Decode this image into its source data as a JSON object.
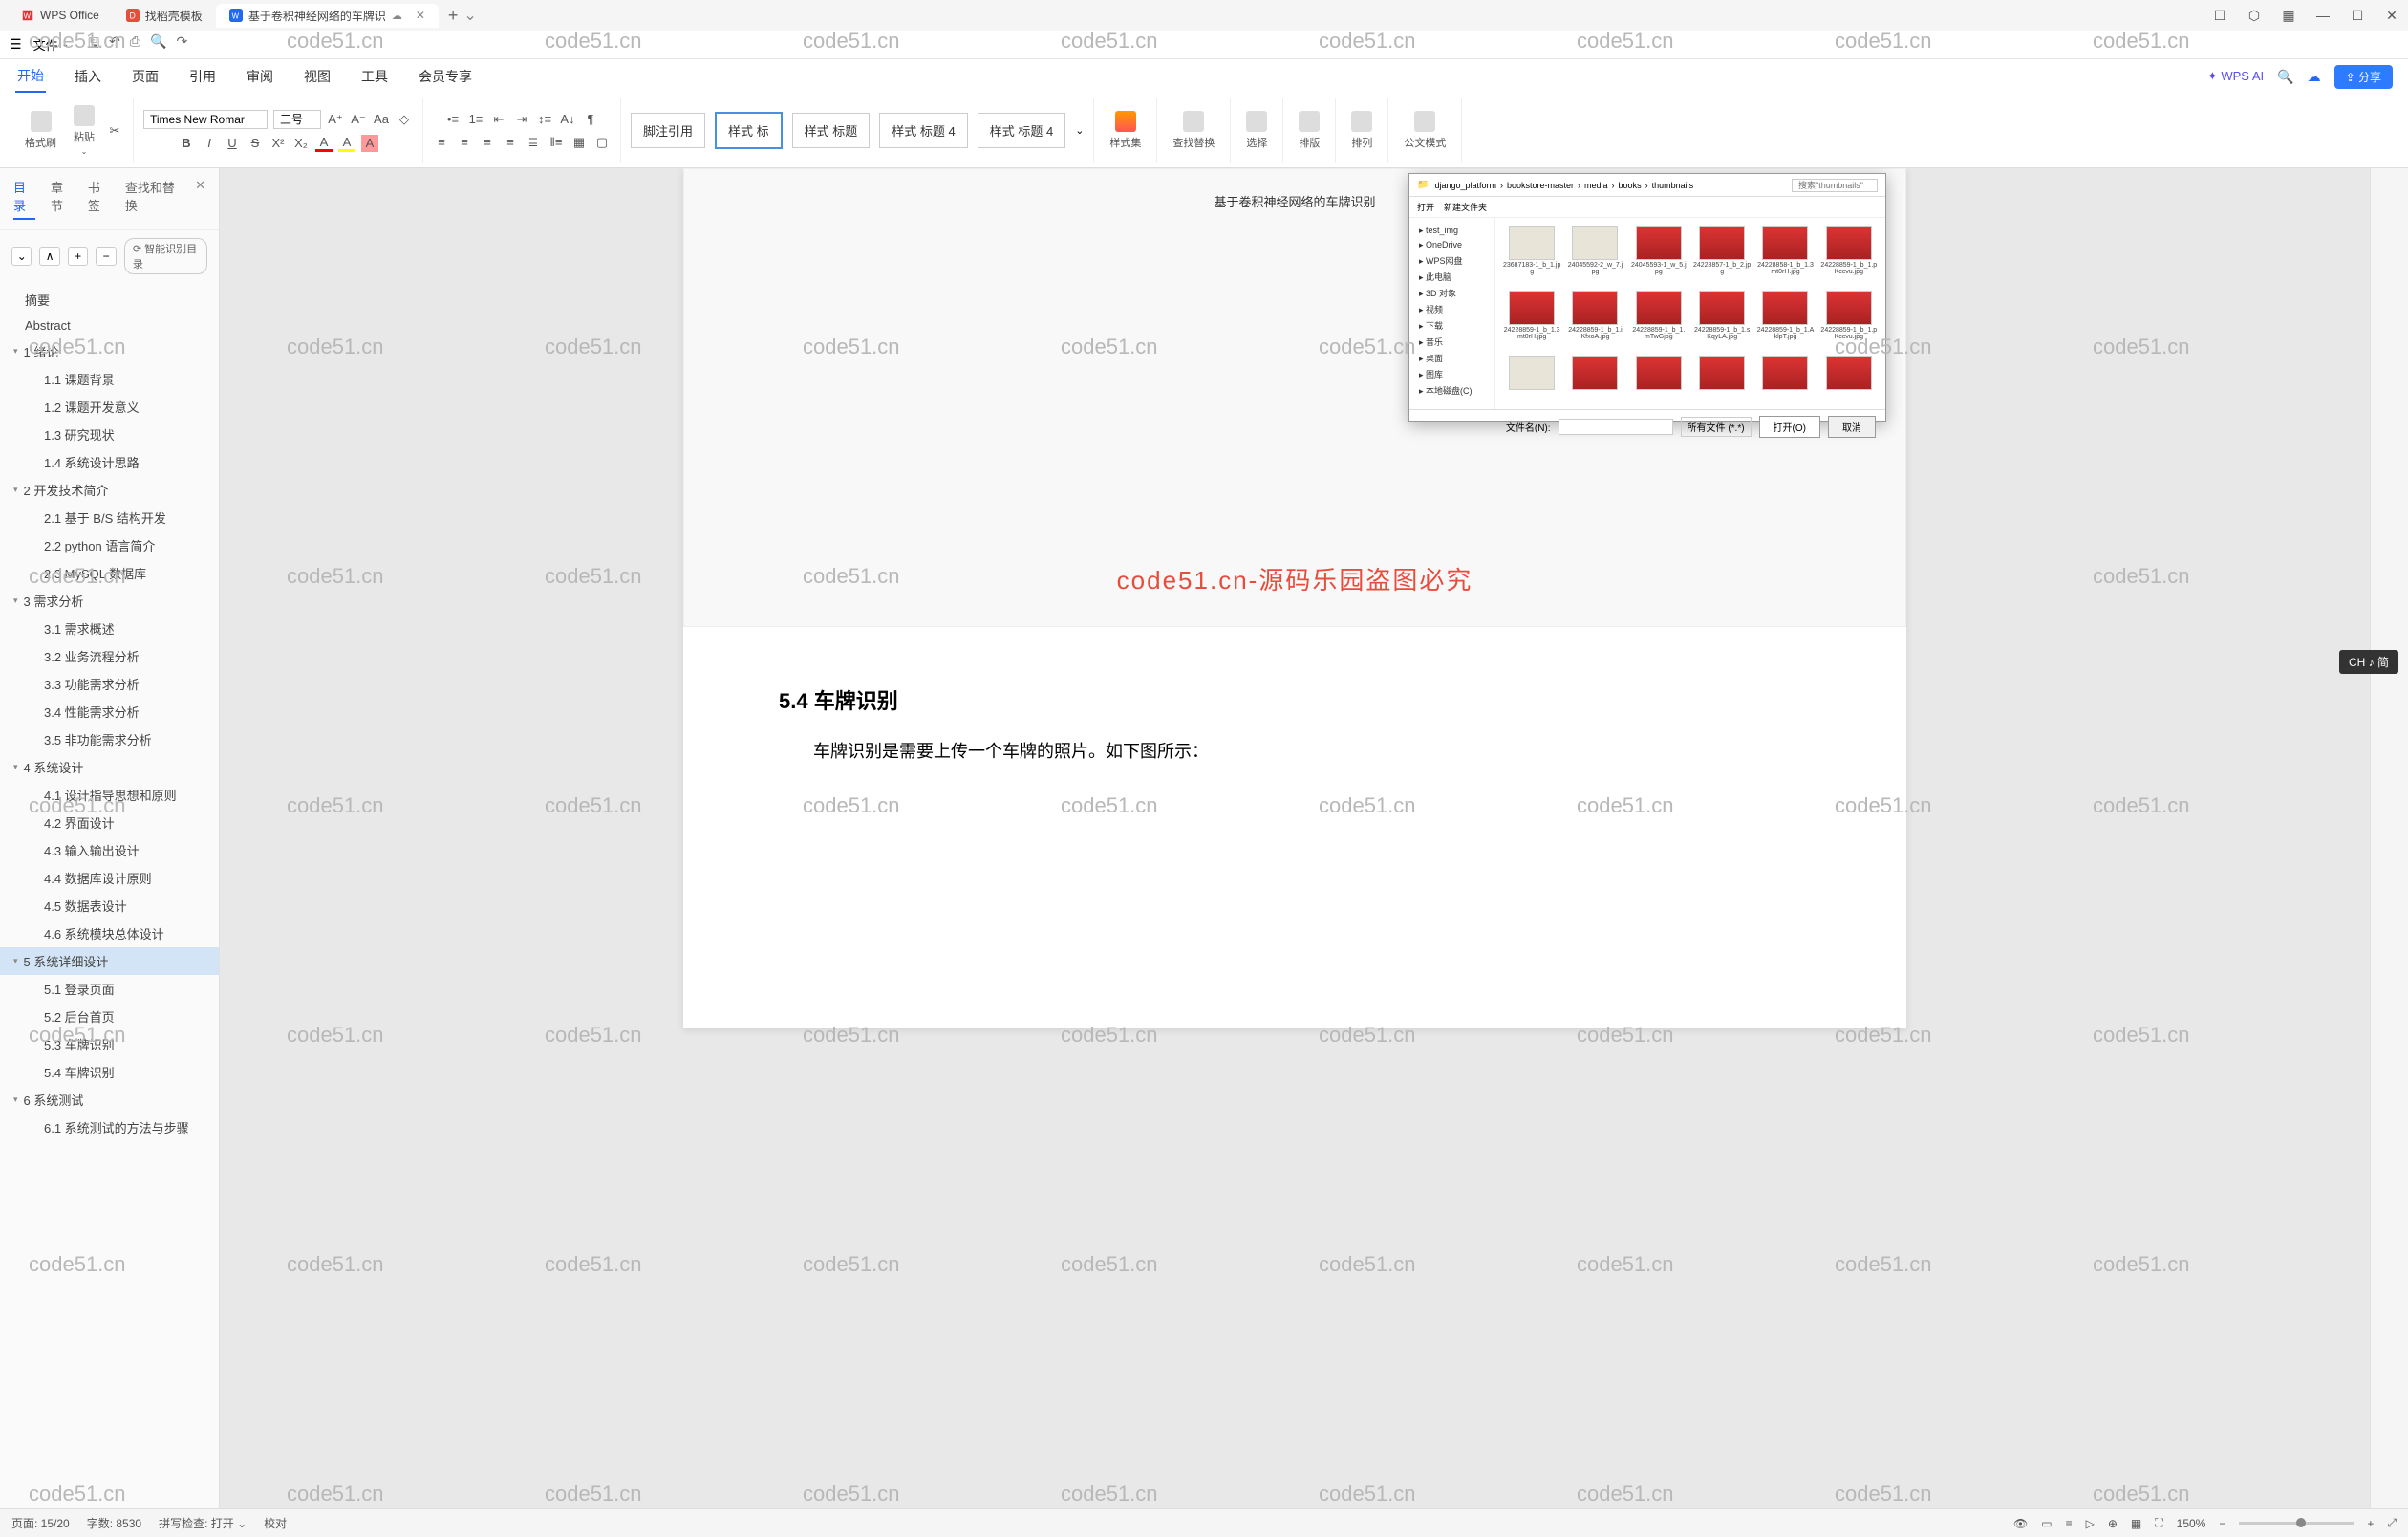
{
  "app": {
    "name": "WPS Office",
    "tabs": [
      {
        "label": "找稻壳模板",
        "icon": "template"
      },
      {
        "label": "基于卷积神经网络的车牌识",
        "icon": "doc",
        "active": true
      }
    ]
  },
  "menu": {
    "file": "文件",
    "ribbon_tabs": [
      "开始",
      "插入",
      "页面",
      "引用",
      "审阅",
      "视图",
      "工具",
      "会员专享"
    ],
    "wps_ai": "WPS AI",
    "share": "分享",
    "cloud_icon": "cloud"
  },
  "toolbar": {
    "format_brush": "格式刷",
    "paste": "粘贴",
    "font": "Times New Romar",
    "size": "三号",
    "bold": "B",
    "italic": "I",
    "underline": "U",
    "strike": "S",
    "footnote": "脚注引用",
    "styles": [
      "样式 标",
      "样式 标题",
      "样式 标题 4",
      "样式 标题 4"
    ],
    "style_set": "样式集",
    "find_replace": "查找替换",
    "select": "选择",
    "layout": "排版",
    "sort": "排列",
    "formula": "公文模式"
  },
  "sidebar": {
    "tabs": [
      "目录",
      "章节",
      "书签",
      "查找和替换"
    ],
    "smart_toc": "智能识别目录",
    "items": [
      {
        "lvl": 0,
        "label": "摘要"
      },
      {
        "lvl": 0,
        "label": "Abstract"
      },
      {
        "lvl": 0,
        "label": "1  绪论",
        "expand": true
      },
      {
        "lvl": 1,
        "label": "1.1  课题背景"
      },
      {
        "lvl": 1,
        "label": "1.2  课题开发意义"
      },
      {
        "lvl": 1,
        "label": "1.3  研究现状"
      },
      {
        "lvl": 1,
        "label": "1.4  系统设计思路"
      },
      {
        "lvl": 0,
        "label": "2  开发技术简介",
        "expand": true
      },
      {
        "lvl": 1,
        "label": "2.1  基于 B/S 结构开发"
      },
      {
        "lvl": 1,
        "label": "2.2  python 语言简介"
      },
      {
        "lvl": 1,
        "label": "2.3  MySQL 数据库"
      },
      {
        "lvl": 0,
        "label": "3  需求分析",
        "expand": true
      },
      {
        "lvl": 1,
        "label": "3.1  需求概述"
      },
      {
        "lvl": 1,
        "label": "3.2  业务流程分析"
      },
      {
        "lvl": 1,
        "label": "3.3  功能需求分析"
      },
      {
        "lvl": 1,
        "label": "3.4  性能需求分析"
      },
      {
        "lvl": 1,
        "label": "3.5  非功能需求分析"
      },
      {
        "lvl": 0,
        "label": "4  系统设计",
        "expand": true
      },
      {
        "lvl": 1,
        "label": "4.1  设计指导思想和原则"
      },
      {
        "lvl": 1,
        "label": "4.2  界面设计"
      },
      {
        "lvl": 1,
        "label": "4.3  输入输出设计"
      },
      {
        "lvl": 1,
        "label": "4.4  数据库设计原则"
      },
      {
        "lvl": 1,
        "label": "4.5 数据表设计"
      },
      {
        "lvl": 1,
        "label": "4.6 系统模块总体设计"
      },
      {
        "lvl": 0,
        "label": "5  系统详细设计",
        "expand": true,
        "selected": true
      },
      {
        "lvl": 1,
        "label": "5.1  登录页面"
      },
      {
        "lvl": 1,
        "label": "5.2  后台首页"
      },
      {
        "lvl": 1,
        "label": "5.3  车牌识别"
      },
      {
        "lvl": 1,
        "label": "5.4  车牌识别"
      },
      {
        "lvl": 0,
        "label": "6  系统测试",
        "expand": true
      },
      {
        "lvl": 1,
        "label": "6.1  系统测试的方法与步骤"
      }
    ]
  },
  "document": {
    "embedded_title": "基于卷积神经网络的车牌识别",
    "watermark_text": "code51.cn-源码乐园盗图必究",
    "heading": "5.4   车牌识别",
    "paragraph": "车牌识别是需要上传一个车牌的照片。如下图所示："
  },
  "popup": {
    "title": "打开",
    "new_folder": "新建文件夹",
    "path": [
      "django_platform",
      "bookstore-master",
      "media",
      "books",
      "thumbnails"
    ],
    "search_placeholder": "搜索\"thumbnails\"",
    "side_items": [
      "test_img",
      "OneDrive",
      "WPS网盘",
      "此电脑",
      "3D 对象",
      "视频",
      "下载",
      "音乐",
      "桌面",
      "图库",
      "本地磁盘(C)"
    ],
    "thumbs": [
      "23687183-1_b_1.jpg",
      "24045592-2_w_7.jpg",
      "24045593-1_w_5.jpg",
      "24228857-1_b_2.jpg",
      "24228858-1_b_1.3mt0rH.jpg",
      "24228859-1_b_1.pKccvu.jpg",
      "24228859-1_b_1.3mt0rH.jpg",
      "24228859-1_b_1.iKfxoA.jpg",
      "24228859-1_b_1.mTwGjpg",
      "24228859-1_b_1.sKqyLA.jpg",
      "24228859-1_b_1.AklpT.jpg",
      "24228859-1_b_1.pKccvu.jpg",
      "",
      "",
      "",
      "",
      "",
      ""
    ],
    "filename_label": "文件名(N):",
    "filter": "所有文件 (*.*)",
    "open": "打开(O)",
    "cancel": "取消"
  },
  "statusbar": {
    "page": "页面: 15/20",
    "words": "字数: 8530",
    "spell": "拼写检查: 打开",
    "proof": "校对",
    "zoom": "150%"
  },
  "lang_badge": "CH ♪ 简",
  "watermark": "code51.cn"
}
